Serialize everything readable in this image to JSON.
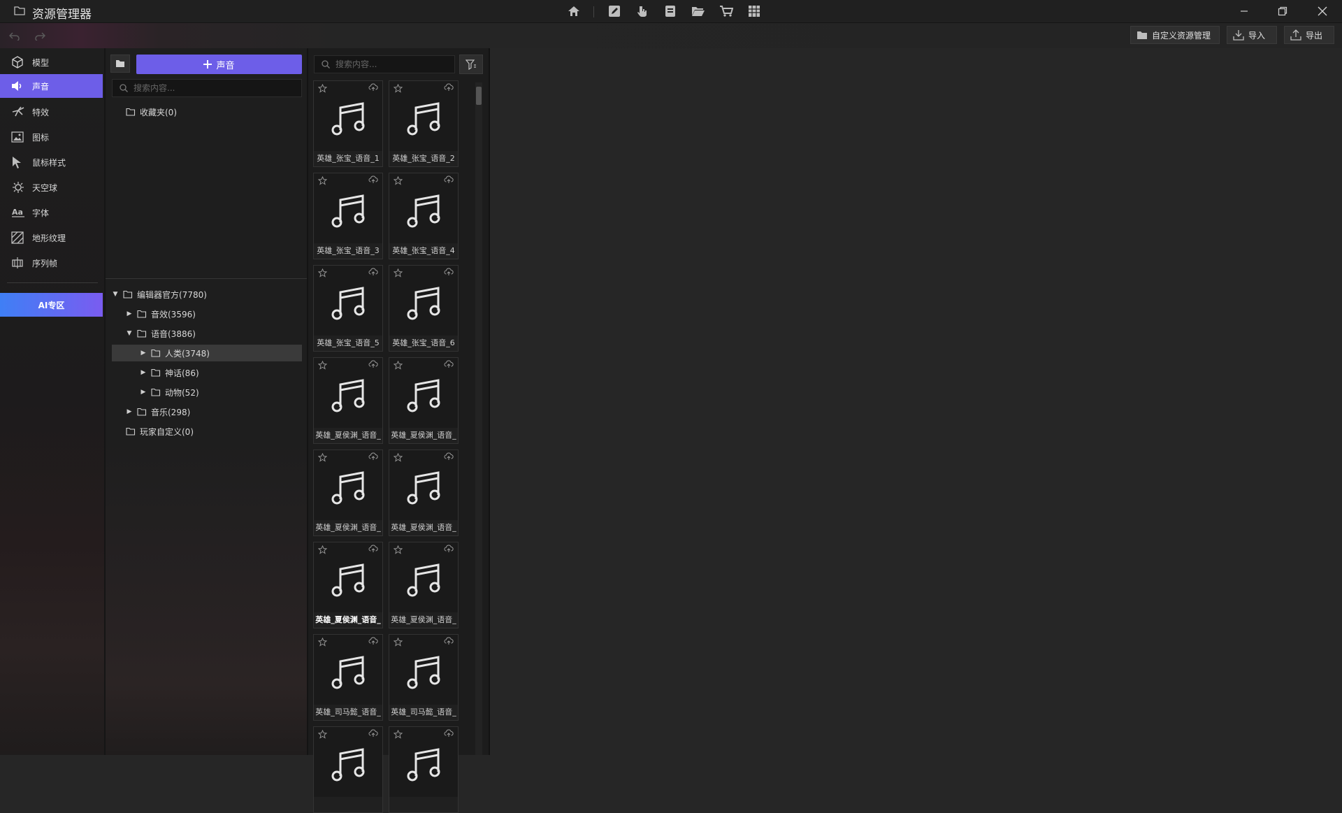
{
  "app": {
    "title": "资源管理器",
    "accent_color": "#6d5ee8"
  },
  "titlebar": {
    "center_icons": [
      "home-icon",
      "edit-icon",
      "pointer-icon",
      "document-icon",
      "open-folder-icon",
      "cart-icon",
      "table-icon"
    ],
    "window_controls": [
      "minimize-icon",
      "restore-icon",
      "close-icon"
    ]
  },
  "toolbar": {
    "custom_manage_label": "自定义资源管理",
    "import_label": "导入",
    "export_label": "导出"
  },
  "nav": {
    "items": [
      {
        "label": "模型",
        "icon": "cube-icon"
      },
      {
        "label": "声音",
        "icon": "speaker-icon",
        "active": true
      },
      {
        "label": "特效",
        "icon": "effects-icon"
      },
      {
        "label": "图标",
        "icon": "image-icon"
      },
      {
        "label": "鼠标样式",
        "icon": "cursor-icon"
      },
      {
        "label": "天空球",
        "icon": "sky-icon"
      },
      {
        "label": "字体",
        "icon": "font-icon"
      },
      {
        "label": "地形纹理",
        "icon": "terrain-icon"
      },
      {
        "label": "序列帧",
        "icon": "sequence-icon"
      }
    ],
    "ai_label": "AI专区"
  },
  "tree_panel": {
    "add_button_label": "声音",
    "search_placeholder": "搜索内容...",
    "favorites": "收藏夹(0)",
    "nodes": [
      {
        "label": "编辑器官方(7780)",
        "depth": 0,
        "caret": "down"
      },
      {
        "label": "音效(3596)",
        "depth": 1,
        "caret": "right"
      },
      {
        "label": "语音(3886)",
        "depth": 1,
        "caret": "down"
      },
      {
        "label": "人类(3748)",
        "depth": 2,
        "caret": "right",
        "selected": true
      },
      {
        "label": "神话(86)",
        "depth": 2,
        "caret": "right"
      },
      {
        "label": "动物(52)",
        "depth": 2,
        "caret": "right"
      },
      {
        "label": "音乐(298)",
        "depth": 1,
        "caret": "right"
      },
      {
        "label": "玩家自定义(0)",
        "depth": 0,
        "caret": "none"
      }
    ]
  },
  "grid_panel": {
    "search_placeholder": "搜索内容...",
    "assets": [
      {
        "label": "英雄_张宝_语音_1"
      },
      {
        "label": "英雄_张宝_语音_2"
      },
      {
        "label": "英雄_张宝_语音_3"
      },
      {
        "label": "英雄_张宝_语音_4"
      },
      {
        "label": "英雄_张宝_语音_5"
      },
      {
        "label": "英雄_张宝_语音_6"
      },
      {
        "label": "英雄_夏侯渊_语音_"
      },
      {
        "label": "英雄_夏侯渊_语音_"
      },
      {
        "label": "英雄_夏侯渊_语音_"
      },
      {
        "label": "英雄_夏侯渊_语音_"
      },
      {
        "label": "英雄_夏侯渊_语音_",
        "bright": true
      },
      {
        "label": "英雄_夏侯渊_语音_"
      },
      {
        "label": "英雄_司马懿_语音_"
      },
      {
        "label": "英雄_司马懿_语音_"
      },
      {
        "label": ""
      },
      {
        "label": ""
      }
    ]
  }
}
